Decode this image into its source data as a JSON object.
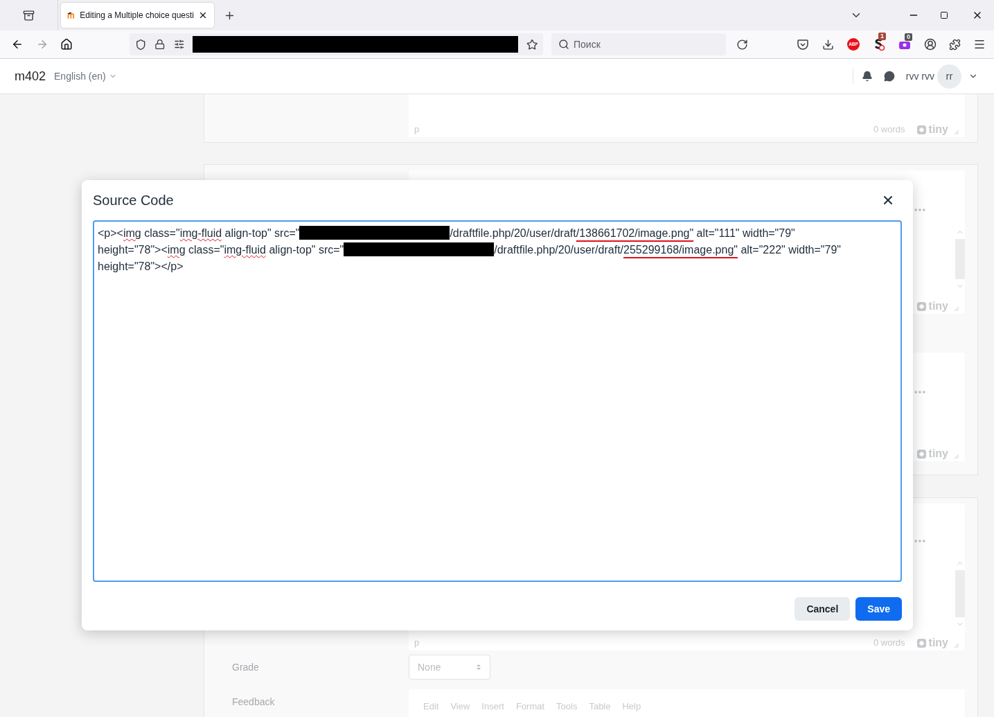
{
  "browser": {
    "tab_title": "Editing a Multiple choice questi",
    "address_redacted": true,
    "search_placeholder": "Поиск",
    "abp_label": "ABP",
    "extension_badges": [
      "1",
      "0"
    ]
  },
  "site": {
    "name": "m402",
    "language": "English (en)",
    "user_name": "rvv rvv",
    "avatar_initials": "rr"
  },
  "background": {
    "editors": [
      {
        "path": "p",
        "word_count": "0 words",
        "logo": "tiny"
      },
      {
        "logo": "tiny"
      },
      {
        "logo": "tiny"
      },
      {
        "path": "p",
        "word_count": "0 words",
        "logo": "tiny"
      }
    ],
    "grade": {
      "label": "Grade",
      "value": "None"
    },
    "feedback": {
      "label": "Feedback",
      "menu": [
        "Edit",
        "View",
        "Insert",
        "Format",
        "Tools",
        "Table",
        "Help"
      ]
    }
  },
  "dialog": {
    "title": "Source Code",
    "lines": [
      [
        {
          "kind": "text",
          "text": "<p><"
        },
        {
          "kind": "misspelled",
          "text": "img"
        },
        {
          "kind": "text",
          "text": " class=\""
        },
        {
          "kind": "misspelled",
          "text": "img-fluid"
        },
        {
          "kind": "text",
          "text": " align-top\" src=\""
        },
        {
          "kind": "redacted"
        },
        {
          "kind": "text",
          "text": "/draftfile.php/20/user/draft"
        },
        {
          "kind": "marked",
          "text": "/138661702/image.png\""
        },
        {
          "kind": "text",
          "text": " alt=\"111\" width=\"79\""
        }
      ],
      [
        {
          "kind": "text",
          "text": "height=\"78\"><"
        },
        {
          "kind": "misspelled",
          "text": "img"
        },
        {
          "kind": "text",
          "text": " class=\""
        },
        {
          "kind": "misspelled",
          "text": "img-fluid"
        },
        {
          "kind": "text",
          "text": " align-top\" src=\""
        },
        {
          "kind": "redacted"
        },
        {
          "kind": "text",
          "text": "/draftfile.php/20/user/draft/"
        },
        {
          "kind": "marked",
          "text": "255299168/image.png\""
        },
        {
          "kind": "text",
          "text": " alt=\"222\" width=\"79\""
        }
      ],
      [
        {
          "kind": "text",
          "text": "height=\"78\"></p>"
        }
      ]
    ],
    "buttons": [
      {
        "label": "Cancel",
        "kind": "secondary"
      },
      {
        "label": "Save",
        "kind": "primary"
      }
    ]
  }
}
